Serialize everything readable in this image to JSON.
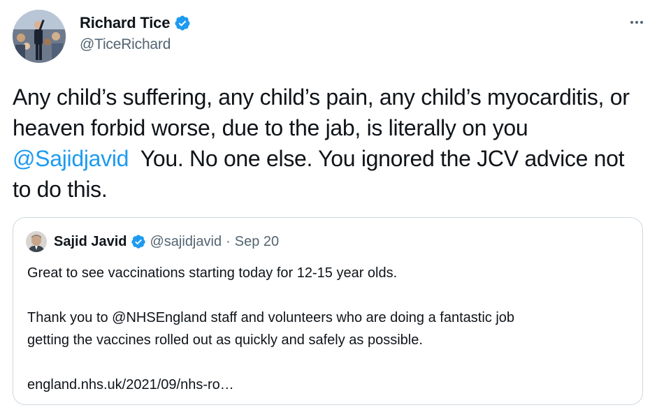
{
  "author": {
    "name": "Richard Tice",
    "handle": "@TiceRichard",
    "verified_icon": "verified-badge-icon",
    "avatar": "profile-photo"
  },
  "more_icon": "ellipsis-icon",
  "tweet": {
    "text_before": "Any child’s suffering, any child’s pain, any child’s myocarditis, or heaven forbid worse, due to the jab, is literally on you ",
    "mention": "@Sajidjavid",
    "text_after": "  You. No one else. You ignored the JCV advice not to do this."
  },
  "quoted_tweet": {
    "name": "Sajid Javid",
    "handle": "@sajidjavid",
    "separator": "·",
    "date": "Sep 20",
    "lines": [
      "Great to see vaccinations starting today for 12-15 year olds.",
      "",
      "Thank you to @NHSEngland staff and volunteers who are doing a fantastic job",
      "getting the vaccines rolled out as quickly and safely as possible.",
      "",
      "england.nhs.uk/2021/09/nhs-ro…"
    ]
  },
  "colors": {
    "link": "#1d9bf0",
    "secondary_text": "#536471",
    "border": "#cfd9de",
    "verified": "#1d9bf0"
  }
}
